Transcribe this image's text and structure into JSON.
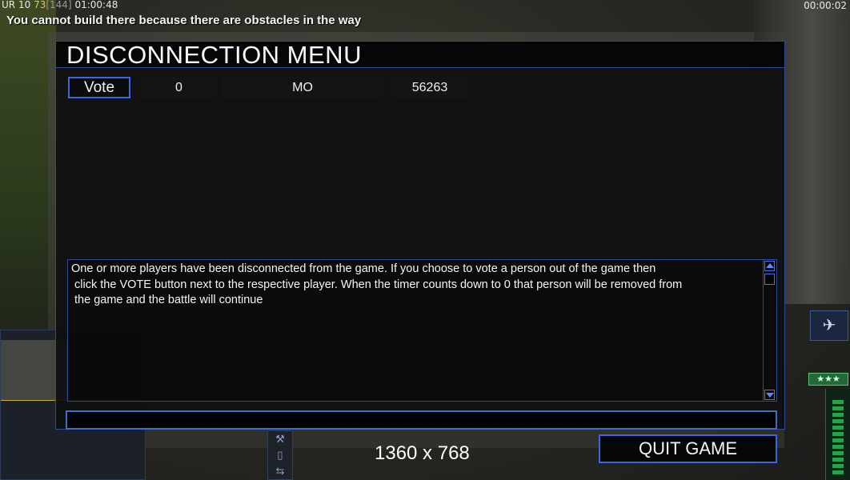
{
  "hud": {
    "faction": "UR",
    "count": "10",
    "power": "73",
    "power_max": "[144]",
    "clock": "01:00:48",
    "game_timer": "00:00:02",
    "message": "You cannot build there because there are obstacles in the way"
  },
  "menu": {
    "title": "DISCONNECTION MENU",
    "players": [
      {
        "vote_label": "Vote",
        "countdown": "0",
        "name": "MO",
        "ping": "56263"
      }
    ],
    "message_text": "One or more players have been disconnected from the game. If you choose to vote a person out of the game then\n click the VOTE button next to the respective player. When the timer counts down to 0 that person will be removed from\n the game and the battle will continue",
    "chat_input_value": "",
    "quit_label": "QUIT GAME"
  },
  "overlay": {
    "resolution": "1360 x 768"
  },
  "colors": {
    "panel_border": "#2f4a9a",
    "button_border": "#3d66e0",
    "text": "#f4f4f4"
  },
  "icons": {
    "scroll_up": "triangle-up-icon",
    "scroll_down": "triangle-down-icon",
    "unit": "satellite-icon",
    "rank": "three-stars-icon"
  }
}
